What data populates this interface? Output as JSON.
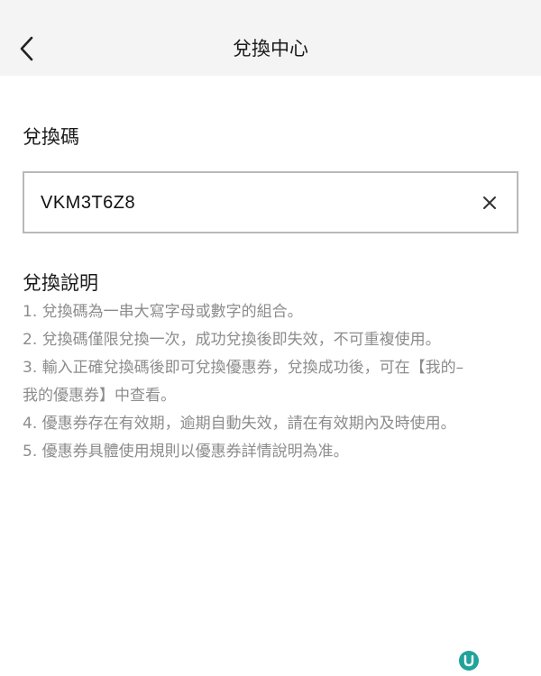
{
  "header": {
    "title": "兌換中心",
    "back_icon": "chevron-left-icon"
  },
  "redeem": {
    "label": "兌換碼",
    "code_value": "VKM3T6Z8",
    "clear_icon": "close-icon"
  },
  "instructions": {
    "title": "兌換說明",
    "items": [
      "1. 兌換碼為一串大寫字母或數字的組合。",
      "2. 兌換碼僅限兌換一次，成功兌換後即失效，不可重複使用。",
      "3. 輸入正確兌換碼後即可兌換優惠券，兌換成功後，可在【我的–",
      "我的優惠券】中查看。",
      "4. 優惠券存在有效期，逾期自動失效，請在有效期內及時使用。",
      "5. 優惠券具體使用規則以優惠券詳情說明為准。"
    ]
  },
  "watermark": {
    "letter": "U",
    "color": "#1fa39a"
  }
}
